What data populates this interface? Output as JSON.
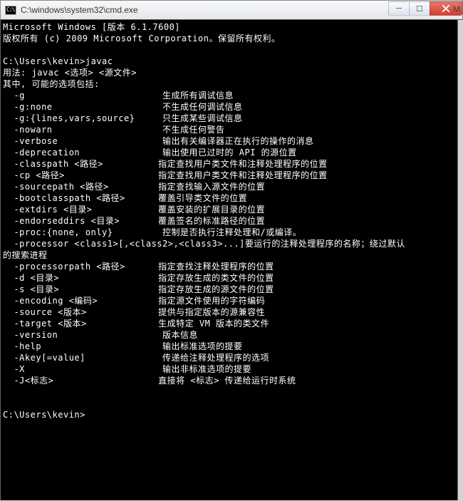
{
  "window": {
    "title": "C:\\windows\\system32\\cmd.exe",
    "background_letter": "M"
  },
  "controls": {
    "minimize": "─",
    "maximize": "☐",
    "close": "×"
  },
  "banner": {
    "line1": "Microsoft Windows [版本 6.1.7600]",
    "line2": "版权所有 (c) 2009 Microsoft Corporation。保留所有权利。"
  },
  "prompt1": "C:\\Users\\kevin>javac",
  "usage": {
    "line1": "用法: javac <选项> <源文件>",
    "line2": "其中, 可能的选项包括:"
  },
  "options": [
    {
      "flag": "-g",
      "desc": "生成所有调试信息"
    },
    {
      "flag": "-g:none",
      "desc": "不生成任何调试信息"
    },
    {
      "flag": "-g:{lines,vars,source}",
      "desc": "只生成某些调试信息"
    },
    {
      "flag": "-nowarn",
      "desc": "不生成任何警告"
    },
    {
      "flag": "-verbose",
      "desc": "输出有关编译器正在执行的操作的消息"
    },
    {
      "flag": "-deprecation",
      "desc": "输出使用已过时的 API 的源位置"
    },
    {
      "flag": "-classpath <路径>",
      "desc": "指定查找用户类文件和注释处理程序的位置"
    },
    {
      "flag": "-cp <路径>",
      "desc": "指定查找用户类文件和注释处理程序的位置"
    },
    {
      "flag": "-sourcepath <路径>",
      "desc": "指定查找输入源文件的位置"
    },
    {
      "flag": "-bootclasspath <路径>",
      "desc": "覆盖引导类文件的位置"
    },
    {
      "flag": "-extdirs <目录>",
      "desc": "覆盖安装的扩展目录的位置"
    },
    {
      "flag": "-endorseddirs <目录>",
      "desc": "覆盖签名的标准路径的位置"
    },
    {
      "flag": "-proc:{none, only}",
      "desc": "控制是否执行注释处理和/或编译。"
    }
  ],
  "processor": {
    "flag": "-processor <class1>[,<class2>,<class3>...]要运行的注释处理程序的名称；绕过默认",
    "cont": "的搜索进程"
  },
  "options2": [
    {
      "flag": "-processorpath <路径>",
      "desc": "指定查找注释处理程序的位置"
    },
    {
      "flag": "-d <目录>",
      "desc": "指定存放生成的类文件的位置"
    },
    {
      "flag": "-s <目录>",
      "desc": "指定存放生成的源文件的位置"
    },
    {
      "flag": "-encoding <编码>",
      "desc": "指定源文件使用的字符编码"
    },
    {
      "flag": "-source <版本>",
      "desc": "提供与指定版本的源兼容性"
    },
    {
      "flag": "-target <版本>",
      "desc": "生成特定 VM 版本的类文件"
    },
    {
      "flag": "-version",
      "desc": "版本信息"
    },
    {
      "flag": "-help",
      "desc": "输出标准选项的提要"
    },
    {
      "flag": "-Akey[=value]",
      "desc": "传递给注释处理程序的选项"
    },
    {
      "flag": "-X",
      "desc": "输出非标准选项的提要"
    },
    {
      "flag": "-J<标志>",
      "desc": "直接将 <标志> 传递给运行时系统"
    }
  ],
  "prompt2": "C:\\Users\\kevin>"
}
